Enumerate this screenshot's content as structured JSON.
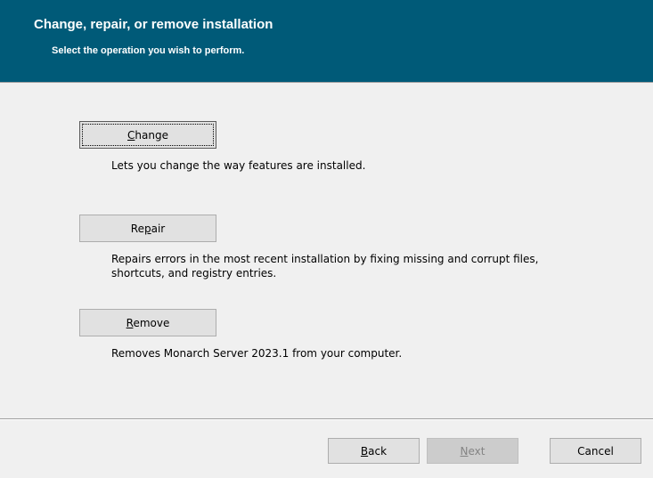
{
  "header": {
    "title": "Change, repair, or remove installation",
    "subtitle": "Select the operation you wish to perform."
  },
  "operations": {
    "change": {
      "label_pre": "",
      "label_accel": "C",
      "label_post": "hange",
      "description": "Lets you change the way features are installed."
    },
    "repair": {
      "label_pre": "Re",
      "label_accel": "p",
      "label_post": "air",
      "description": "Repairs errors in the most recent installation by fixing missing and corrupt files, shortcuts, and registry entries."
    },
    "remove": {
      "label_pre": "",
      "label_accel": "R",
      "label_post": "emove",
      "description": "Removes Monarch Server 2023.1 from your computer."
    }
  },
  "footer": {
    "back": {
      "label_pre": "",
      "label_accel": "B",
      "label_post": "ack"
    },
    "next": {
      "label_pre": "",
      "label_accel": "N",
      "label_post": "ext"
    },
    "cancel": {
      "label": "Cancel"
    }
  },
  "colors": {
    "header_background": "#005a78",
    "header_text": "#ffffff",
    "dialog_background": "#f0f0f0"
  }
}
